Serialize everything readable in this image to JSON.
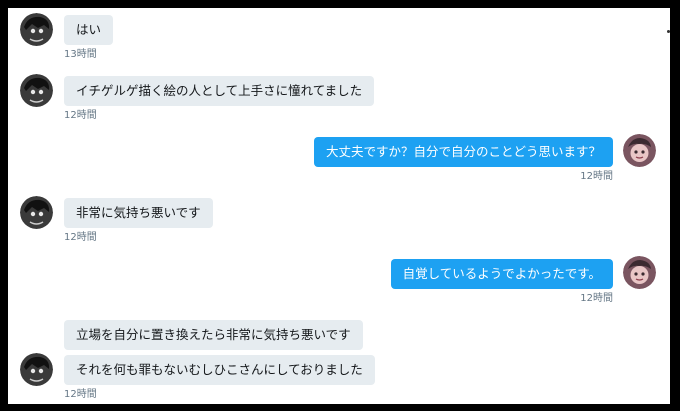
{
  "conversation": {
    "messages": [
      {
        "side": "in",
        "text": "はい",
        "time": "13時間"
      },
      {
        "side": "in",
        "text": "イチゲルゲ描く絵の人として上手さに憧れてました",
        "time": "12時間"
      },
      {
        "side": "out",
        "text": "大丈夫ですか？自分で自分のことどう思います？",
        "time": "12時間"
      },
      {
        "side": "in",
        "text": "非常に気持ち悪いです",
        "time": "12時間"
      },
      {
        "side": "out",
        "text": "自覚しているようでよかったです。",
        "time": "12時間"
      },
      {
        "side": "in",
        "text": "立場を自分に置き換えたら非常に気持ち悪いです",
        "time": ""
      },
      {
        "side": "in",
        "text": "それを何も罪もないむしひこさんにしておりました",
        "time": "12時間"
      }
    ]
  },
  "colors": {
    "incoming_bubble": "#e6ecf0",
    "outgoing_bubble": "#1da1f2",
    "timestamp": "#657786"
  },
  "icons": {
    "incoming_avatar": "user-avatar-icon",
    "outgoing_avatar": "user-avatar-icon"
  }
}
